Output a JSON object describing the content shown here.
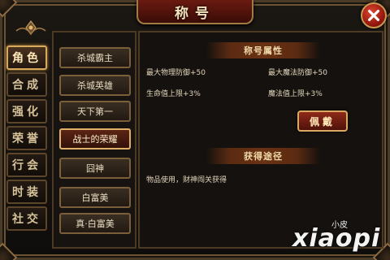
{
  "window": {
    "title": "称号",
    "close_icon": "close-x-icon"
  },
  "tabs": [
    {
      "label": "角色",
      "active": true
    },
    {
      "label": "合成",
      "active": false
    },
    {
      "label": "强化",
      "active": false
    },
    {
      "label": "荣誉",
      "active": false
    },
    {
      "label": "行会",
      "active": false
    },
    {
      "label": "时装",
      "active": false
    },
    {
      "label": "社交",
      "active": false
    }
  ],
  "titles_list": [
    {
      "label": "杀城霸主",
      "selected": false
    },
    {
      "label": "杀城英雄",
      "selected": false
    },
    {
      "label": "天下第一",
      "selected": false
    },
    {
      "label": "战士的荣耀",
      "selected": true
    },
    {
      "label": "囧神",
      "selected": false
    },
    {
      "label": "白富美",
      "selected": false
    },
    {
      "label": "真·白富美",
      "selected": false
    }
  ],
  "attributes": {
    "heading": "称号属性",
    "items": [
      "最大物理防御+50",
      "最大魔法防御+50",
      "生命值上限+3%",
      "魔法值上限+3%"
    ]
  },
  "wear_button": {
    "label": "佩戴"
  },
  "acquire": {
    "heading": "获得途径",
    "text": "物品使用，财神闯关获得"
  },
  "watermark": {
    "small": "小皮",
    "big": "xiaopi"
  },
  "colors": {
    "accent_gold": "#d8a85d",
    "button_red": "#8e2a18",
    "panel_bg": "#15110e"
  }
}
